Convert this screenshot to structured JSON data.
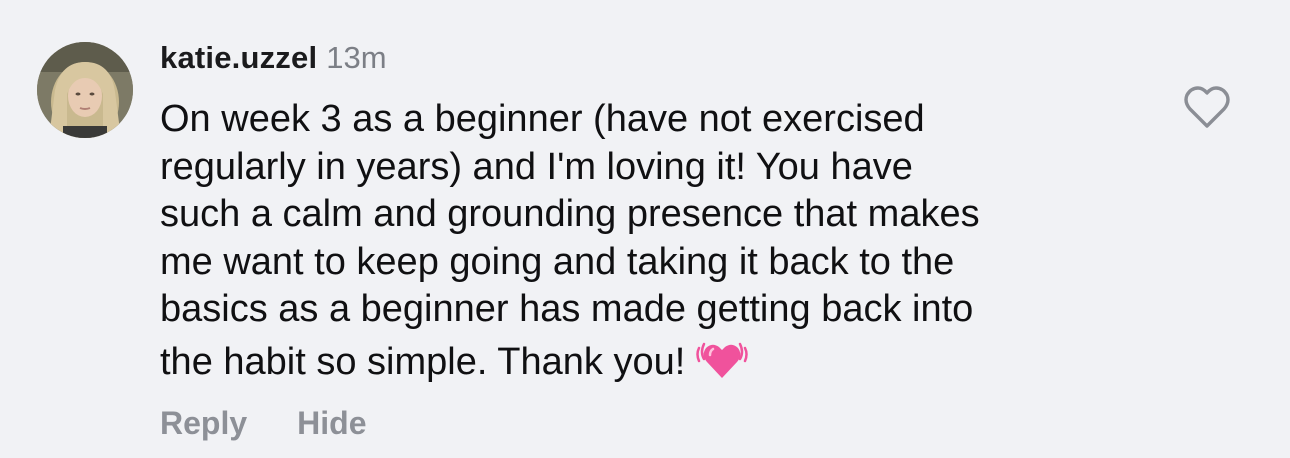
{
  "comment": {
    "username": "katie.uzzel",
    "timestamp": "13m",
    "text_lines": [
      "On week 3 as a beginner (have not exercised",
      "regularly in years) and I'm loving it! You have",
      "such a calm and grounding presence that makes",
      "me want to keep going and taking it back to the",
      "basics as a beginner has made getting back into",
      "the habit so simple. Thank you!"
    ],
    "emoji": "beating-heart-emoji",
    "actions": {
      "reply_label": "Reply",
      "hide_label": "Hide"
    },
    "like_icon": "heart-outline-icon"
  },
  "colors": {
    "background": "#f1f2f5",
    "username": "#1b1b1d",
    "timestamp": "#7c7f86",
    "action": "#8d9097",
    "heart_emoji": "#f0529c"
  }
}
